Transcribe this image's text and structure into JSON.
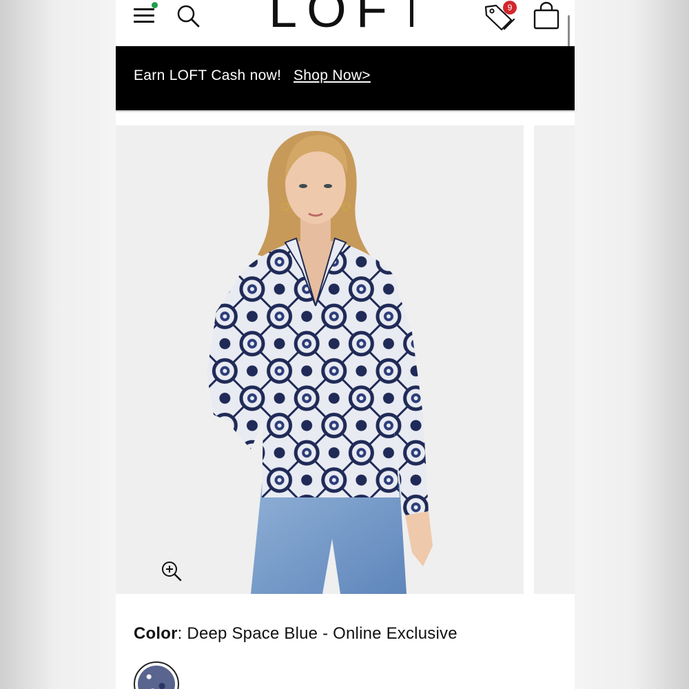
{
  "header": {
    "logo_text": "LOFT",
    "cart_badge_count": "9",
    "icons": [
      "hamburger-menu-icon",
      "search-icon",
      "tags-icon",
      "shopping-bag-icon"
    ],
    "notification_dot_color": "#1e9e4a",
    "badge_color": "#d0282e"
  },
  "promo": {
    "text": "Earn LOFT Cash now!",
    "link_label": "Shop Now>"
  },
  "product": {
    "zoom_icon": "zoom-in-icon",
    "color_label": "Color",
    "color_value": ": Deep Space Blue - Online Exclusive",
    "swatch_color": "#59648f"
  }
}
